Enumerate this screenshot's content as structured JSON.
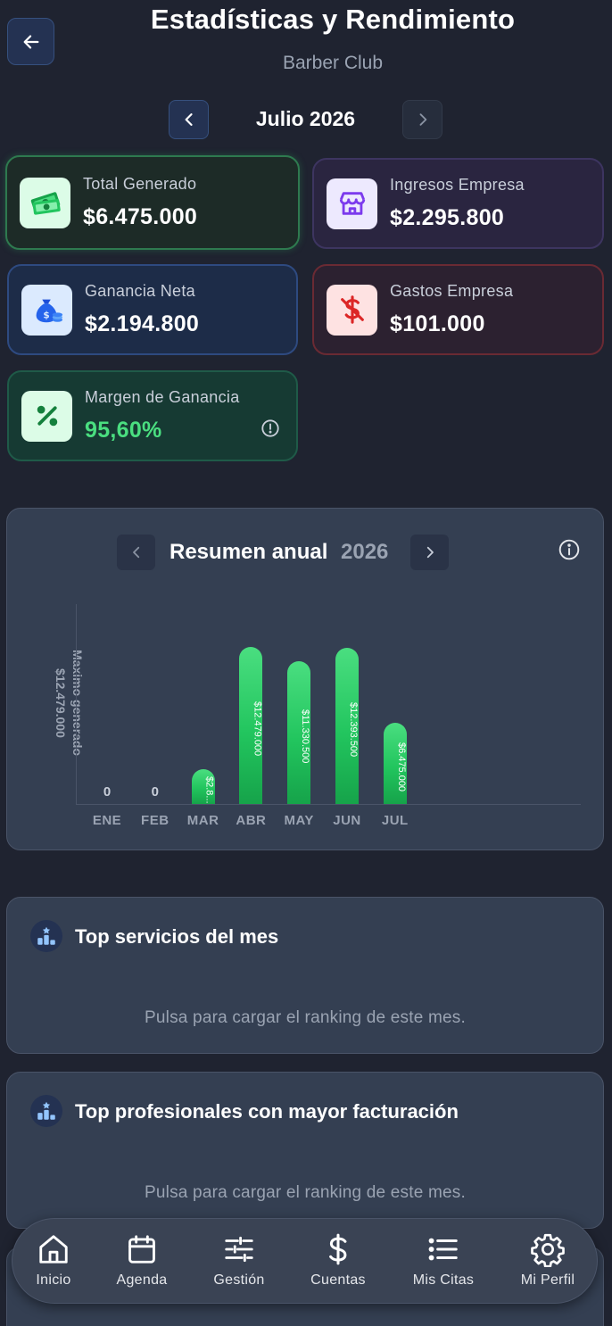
{
  "header": {
    "title": "Estadísticas y Rendimiento",
    "subtitle": "Barber Club",
    "month": "Julio 2026"
  },
  "cards": {
    "total": {
      "label": "Total Generado",
      "value": "$6.475.000",
      "icon": "money-icon"
    },
    "ingresos": {
      "label": "Ingresos Empresa",
      "value": "$2.295.800",
      "icon": "store-icon"
    },
    "neta": {
      "label": "Ganancia Neta",
      "value": "$2.194.800",
      "icon": "money-bag-icon"
    },
    "gastos": {
      "label": "Gastos Empresa",
      "value": "$101.000",
      "icon": "dollar-icon"
    },
    "margen": {
      "label": "Margen de Ganancia",
      "value": "95,60%",
      "icon": "percent-icon"
    }
  },
  "annual": {
    "title": "Resumen anual",
    "year": "2026",
    "ylabel_line1": "Maximo generado",
    "ylabel_line2": "$12.479.000",
    "zero_label": "0"
  },
  "chart_data": {
    "type": "bar",
    "title": "Resumen anual 2026",
    "categories": [
      "ENE",
      "FEB",
      "MAR",
      "ABR",
      "MAY",
      "JUN",
      "JUL"
    ],
    "values": [
      0,
      0,
      2800000,
      12479000,
      11330500,
      12393500,
      6475000
    ],
    "labels": [
      "0",
      "0",
      "$2.8...",
      "$12.479.000",
      "$11.330.500",
      "$12.393.500",
      "$6.475.000"
    ],
    "ylabel": "Maximo generado $12.479.000",
    "ylim": [
      0,
      12479000
    ],
    "colors": {
      "bar": "#22c55e"
    }
  },
  "rankings": {
    "services": {
      "title": "Top servicios del mes",
      "hint": "Pulsa para cargar el ranking de este mes."
    },
    "professionals": {
      "title": "Top profesionales con mayor facturación",
      "hint": "Pulsa para cargar el ranking de este mes."
    }
  },
  "nav": {
    "items": [
      {
        "label": "Inicio",
        "icon": "home-icon"
      },
      {
        "label": "Agenda",
        "icon": "calendar-icon"
      },
      {
        "label": "Gestión",
        "icon": "sliders-icon"
      },
      {
        "label": "Cuentas",
        "icon": "dollar-icon"
      },
      {
        "label": "Mis Citas",
        "icon": "list-icon"
      },
      {
        "label": "Mi Perfil",
        "icon": "gear-icon"
      }
    ]
  }
}
